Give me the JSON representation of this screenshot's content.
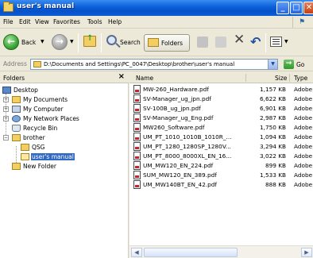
{
  "window": {
    "title": "user's manual"
  },
  "menu": [
    "File",
    "Edit",
    "View",
    "Favorites",
    "Tools",
    "Help"
  ],
  "toolbar": {
    "back_label": "Back",
    "search_label": "Search",
    "folders_label": "Folders"
  },
  "address": {
    "label": "Address",
    "path": "D:\\Documents and Settings\\PC_0047\\Desktop\\brother\\user's manual",
    "go_label": "Go"
  },
  "folders_pane": {
    "title": "Folders",
    "close_glyph": "×",
    "tree": [
      {
        "label": "Desktop",
        "icon": "desktop-icon",
        "expander": ""
      },
      {
        "label": "My Documents",
        "icon": "my-documents-icon",
        "expander": "+"
      },
      {
        "label": "My Computer",
        "icon": "my-computer-icon",
        "expander": "+"
      },
      {
        "label": "My Network Places",
        "icon": "network-places-icon",
        "expander": "+"
      },
      {
        "label": "Recycle Bin",
        "icon": "recycle-bin-icon",
        "expander": ""
      },
      {
        "label": "brother",
        "icon": "folder-icon",
        "expander": "−"
      },
      {
        "label": "QSG",
        "icon": "folder-icon",
        "expander": ""
      },
      {
        "label": "user's manual",
        "icon": "open-folder-icon",
        "expander": "",
        "selected": true
      },
      {
        "label": "New Folder",
        "icon": "folder-icon",
        "expander": ""
      }
    ]
  },
  "file_list": {
    "columns": {
      "name": "Name",
      "size": "Size",
      "type": "Type"
    },
    "files": [
      {
        "name": "MW-260_Hardware.pdf",
        "size": "1,157 KB",
        "type": "Adobe"
      },
      {
        "name": "SV-Manager_ug_jpn.pdf",
        "size": "6,622 KB",
        "type": "Adobe"
      },
      {
        "name": "SV-100B_ug_jpn.pdf",
        "size": "6,901 KB",
        "type": "Adobe"
      },
      {
        "name": "SV-Manager_ug_Eng.pdf",
        "size": "2,987 KB",
        "type": "Adobe"
      },
      {
        "name": "MW260_Software.pdf",
        "size": "1,750 KB",
        "type": "Adobe"
      },
      {
        "name": "UM_PT_1010_1010B_1010R_...",
        "size": "1,094 KB",
        "type": "Adobe"
      },
      {
        "name": "UM_PT_1280_1280SP_1280V...",
        "size": "3,294 KB",
        "type": "Adobe"
      },
      {
        "name": "UM_PT_8000_8000XL_EN_16...",
        "size": "3,022 KB",
        "type": "Adobe"
      },
      {
        "name": "UM_MW120_EN_224.pdf",
        "size": "899 KB",
        "type": "Adobe"
      },
      {
        "name": "SUM_MW120_EN_389.pdf",
        "size": "1,533 KB",
        "type": "Adobe"
      },
      {
        "name": "UM_MW140BT_EN_42.pdf",
        "size": "888 KB",
        "type": "Adobe"
      }
    ]
  },
  "colors": {
    "titlebar": "#0a5fd8",
    "selection": "#316ac5",
    "pdf_accent": "#c8232c"
  }
}
